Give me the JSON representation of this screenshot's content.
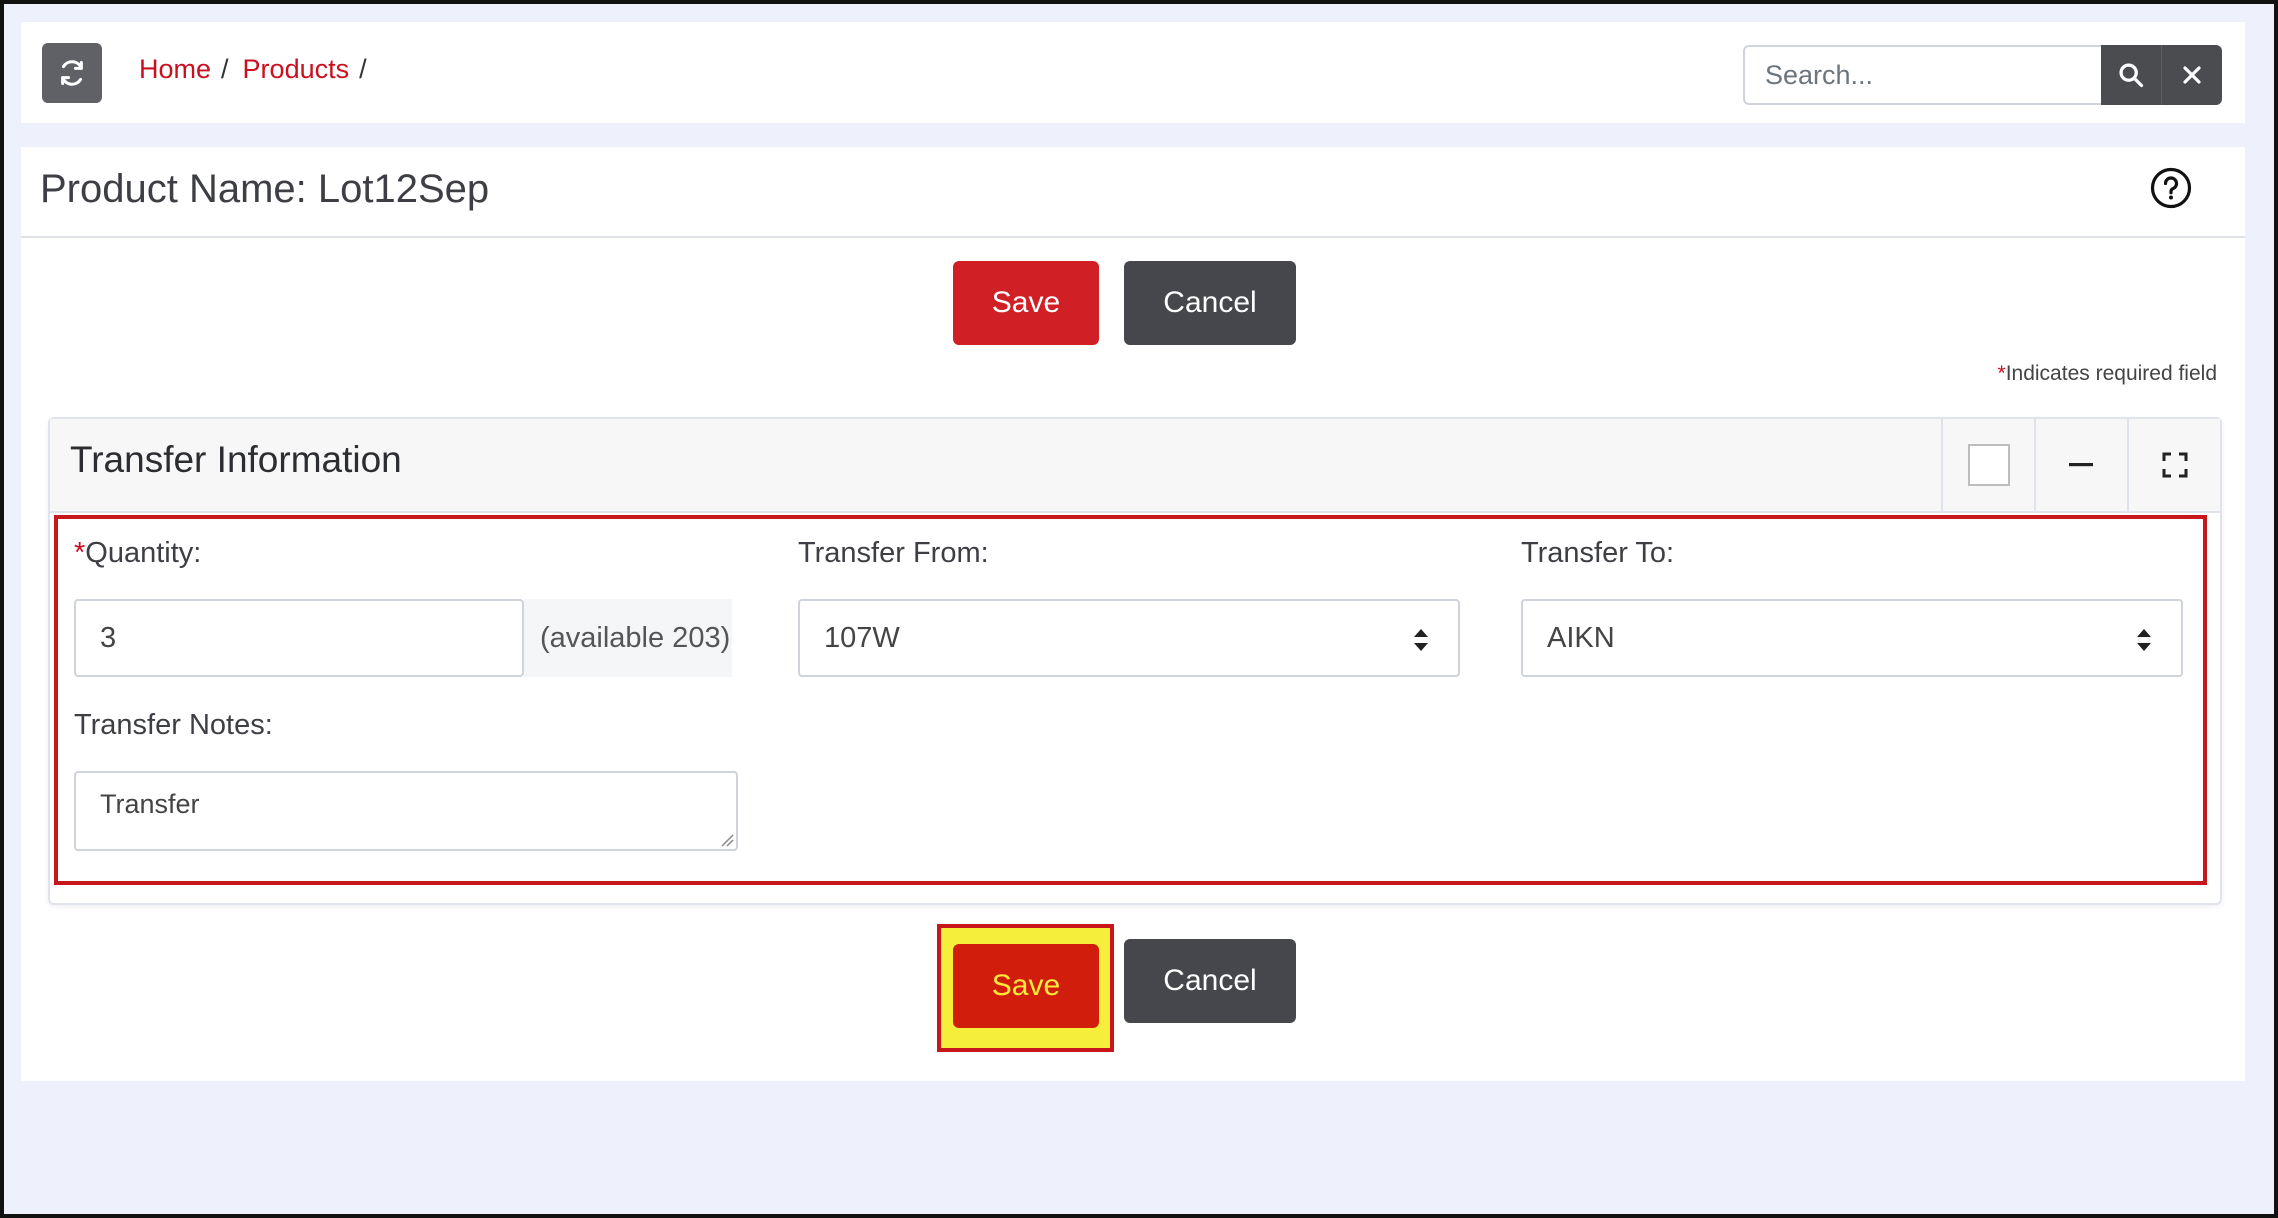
{
  "header": {
    "refresh_icon": "refresh-icon",
    "breadcrumb": [
      {
        "label": "Home"
      },
      {
        "label": "Products"
      }
    ],
    "breadcrumb_separator": "/",
    "search": {
      "placeholder": "Search...",
      "value": ""
    },
    "search_icon": "search-icon",
    "clear_icon": "close-icon"
  },
  "page": {
    "title": "Product Name: Lot12Sep",
    "help_icon": "question-circle-icon"
  },
  "actions_top": {
    "save_label": "Save",
    "cancel_label": "Cancel"
  },
  "required_note": {
    "star": "*",
    "text": "Indicates required field"
  },
  "card": {
    "title": "Transfer Information",
    "tools": [
      "checkbox",
      "minimize-icon",
      "expand-icon"
    ]
  },
  "form": {
    "quantity": {
      "star": "*",
      "label": "Quantity:",
      "value": "3",
      "addon": "(available 203)"
    },
    "transfer_from": {
      "label": "Transfer From:",
      "value": "107W"
    },
    "transfer_to": {
      "label": "Transfer To:",
      "value": "AIKN"
    },
    "notes": {
      "label": "Transfer Notes:",
      "value": "Transfer"
    }
  },
  "actions_bottom": {
    "save_label": "Save",
    "cancel_label": "Cancel"
  },
  "colors": {
    "accent_red": "#d01f25",
    "dark_button": "#45474c",
    "link_red": "#c8101f",
    "highlight_yellow": "#f5ee3a"
  }
}
